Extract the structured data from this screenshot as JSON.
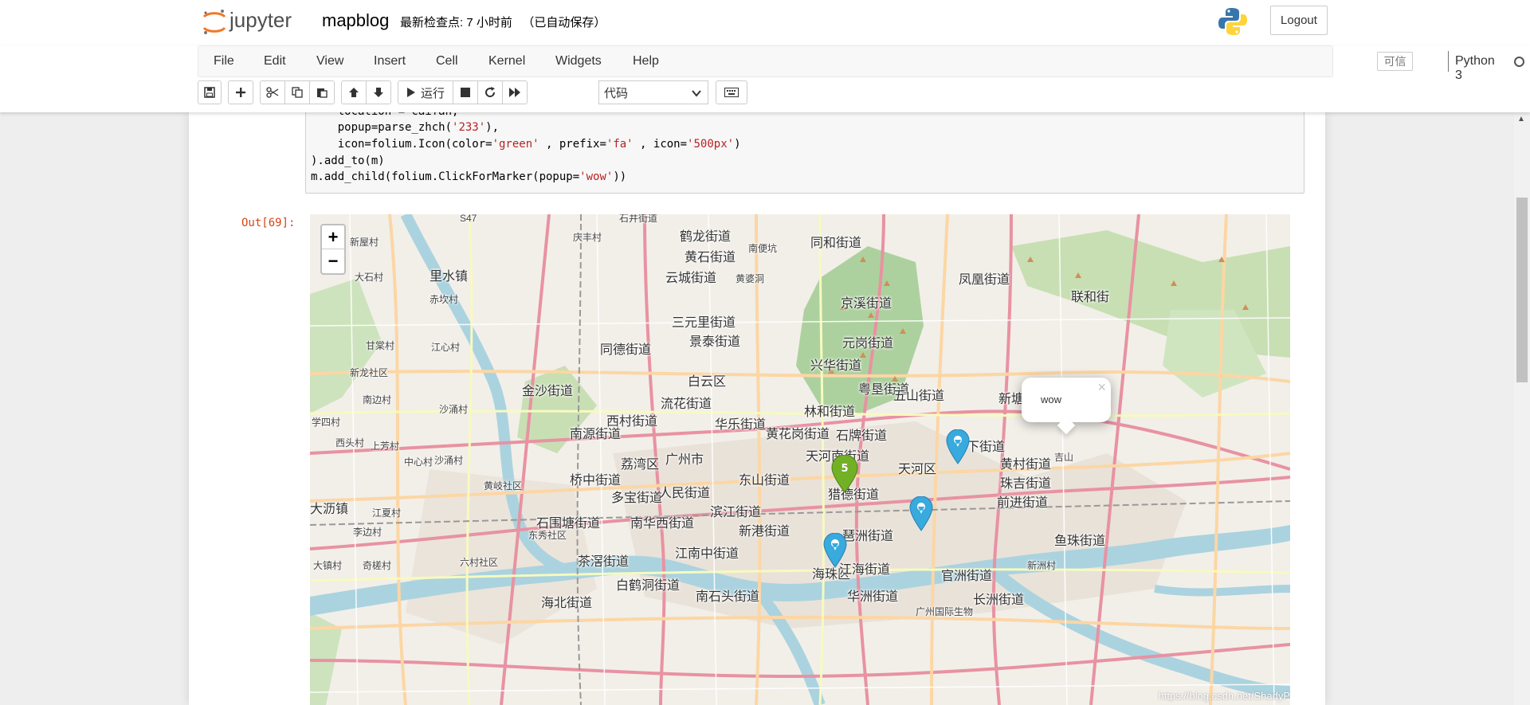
{
  "header": {
    "brand": "jupyter",
    "notebook_name": "mapblog",
    "checkpoint": "最新检查点: 7 小时前   （已自动保存）",
    "logout_label": "Logout"
  },
  "menubar": {
    "items": [
      "File",
      "Edit",
      "View",
      "Insert",
      "Cell",
      "Kernel",
      "Widgets",
      "Help"
    ],
    "trusted": "可信",
    "kernel": "Python 3"
  },
  "toolbar": {
    "run_label": "运行",
    "cell_type": "代码"
  },
  "cell": {
    "code_lines": [
      "    location = caifan,",
      "    popup=parse_zhch('233'),",
      "    icon=folium.Icon(color='green' , prefix='fa' , icon='500px')",
      ").add_to(m)",
      "",
      "m.add_child(folium.ClickForMarker(popup='wow'))"
    ],
    "out_prompt": "Out[69]:"
  },
  "map": {
    "popup_text": "wow",
    "popup_close": "×",
    "zoom_in": "+",
    "zoom_out": "−",
    "attribution": "https://blog.csdn.net/ShadyP",
    "labels": [
      {
        "t": "石井街道",
        "c": "small"
      },
      {
        "t": "S47",
        "c": "small"
      },
      {
        "t": "庆丰村",
        "c": "small"
      },
      {
        "t": "鹤龙街道",
        "c": "big"
      },
      {
        "t": "同和街道",
        "c": "big"
      },
      {
        "t": "新屋村",
        "c": "small"
      },
      {
        "t": "黄石街道",
        "c": "big"
      },
      {
        "t": "南便坑",
        "c": "small"
      },
      {
        "t": "大石村",
        "c": "small"
      },
      {
        "t": "里水镇",
        "c": "big"
      },
      {
        "t": "凤凰街道",
        "c": "big"
      },
      {
        "t": "云城街道",
        "c": "big"
      },
      {
        "t": "黄婆洞",
        "c": "small"
      },
      {
        "t": "赤坎村",
        "c": "small"
      },
      {
        "t": "京溪街道",
        "c": "big"
      },
      {
        "t": "联和街",
        "c": "big"
      },
      {
        "t": "三元里街道",
        "c": "big"
      },
      {
        "t": "景泰街道",
        "c": "big"
      },
      {
        "t": "元岗街道",
        "c": "big"
      },
      {
        "t": "甘棠村",
        "c": "small"
      },
      {
        "t": "江心村",
        "c": "small"
      },
      {
        "t": "同德街道",
        "c": "big"
      },
      {
        "t": "兴华街道",
        "c": "big"
      },
      {
        "t": "新龙社区",
        "c": "small"
      },
      {
        "t": "金沙街道",
        "c": "big"
      },
      {
        "t": "白云区",
        "c": "big"
      },
      {
        "t": "粤垦街道",
        "c": "big"
      },
      {
        "t": "五山街道",
        "c": "big"
      },
      {
        "t": "南边村",
        "c": "small"
      },
      {
        "t": "流花街道",
        "c": "big"
      },
      {
        "t": "林和街道",
        "c": "big"
      },
      {
        "t": "新塘街道",
        "c": "big"
      },
      {
        "t": "沙涌村",
        "c": "small"
      },
      {
        "t": "西村街道",
        "c": "big"
      },
      {
        "t": "华乐街道",
        "c": "big"
      },
      {
        "t": "黄花岗街道",
        "c": "big"
      },
      {
        "t": "石牌街道",
        "c": "big"
      },
      {
        "t": "学四村",
        "c": "small"
      },
      {
        "t": "南源街道",
        "c": "big"
      },
      {
        "t": "棠下街道",
        "c": "big"
      },
      {
        "t": "西头村",
        "c": "small"
      },
      {
        "t": "上芳村",
        "c": "small"
      },
      {
        "t": "荔湾区",
        "c": "big"
      },
      {
        "t": "广州市",
        "c": "big"
      },
      {
        "t": "天河南街道",
        "c": "big"
      },
      {
        "t": "天河区",
        "c": "big"
      },
      {
        "t": "黄村街道",
        "c": "big"
      },
      {
        "t": "吉山",
        "c": "small"
      },
      {
        "t": "中心村",
        "c": "small"
      },
      {
        "t": "沙涌村",
        "c": "small"
      },
      {
        "t": "桥中街道",
        "c": "big"
      },
      {
        "t": "东山街道",
        "c": "big"
      },
      {
        "t": "珠吉街道",
        "c": "big"
      },
      {
        "t": "黄岐社区",
        "c": "small"
      },
      {
        "t": "多宝街道",
        "c": "big"
      },
      {
        "t": "人民街道",
        "c": "big"
      },
      {
        "t": "猎德街道",
        "c": "big"
      },
      {
        "t": "前进街道",
        "c": "big"
      },
      {
        "t": "石围塘街道",
        "c": "big"
      },
      {
        "t": "滨江街道",
        "c": "big"
      },
      {
        "t": "大沥镇",
        "c": "big"
      },
      {
        "t": "江夏村",
        "c": "small"
      },
      {
        "t": "南华西街道",
        "c": "big"
      },
      {
        "t": "新港街道",
        "c": "big"
      },
      {
        "t": "琶洲街道",
        "c": "big"
      },
      {
        "t": "鱼珠街道",
        "c": "big"
      },
      {
        "t": "李边村",
        "c": "small"
      },
      {
        "t": "东秀社区",
        "c": "small"
      },
      {
        "t": "茶滘街道",
        "c": "big"
      },
      {
        "t": "江南中街道",
        "c": "big"
      },
      {
        "t": "官洲街道",
        "c": "big"
      },
      {
        "t": "新洲村",
        "c": "small"
      },
      {
        "t": "大镇村",
        "c": "small"
      },
      {
        "t": "奇槎村",
        "c": "small"
      },
      {
        "t": "六村社区",
        "c": "small"
      },
      {
        "t": "海珠区",
        "c": "big"
      },
      {
        "t": "江海街道",
        "c": "big"
      },
      {
        "t": "长洲街道",
        "c": "big"
      },
      {
        "t": "白鹤洞街道",
        "c": "big"
      },
      {
        "t": "南石头街道",
        "c": "big"
      },
      {
        "t": "华洲街道",
        "c": "big"
      },
      {
        "t": "海北街道",
        "c": "big"
      },
      {
        "t": "广州国际生物",
        "c": "small"
      }
    ]
  }
}
